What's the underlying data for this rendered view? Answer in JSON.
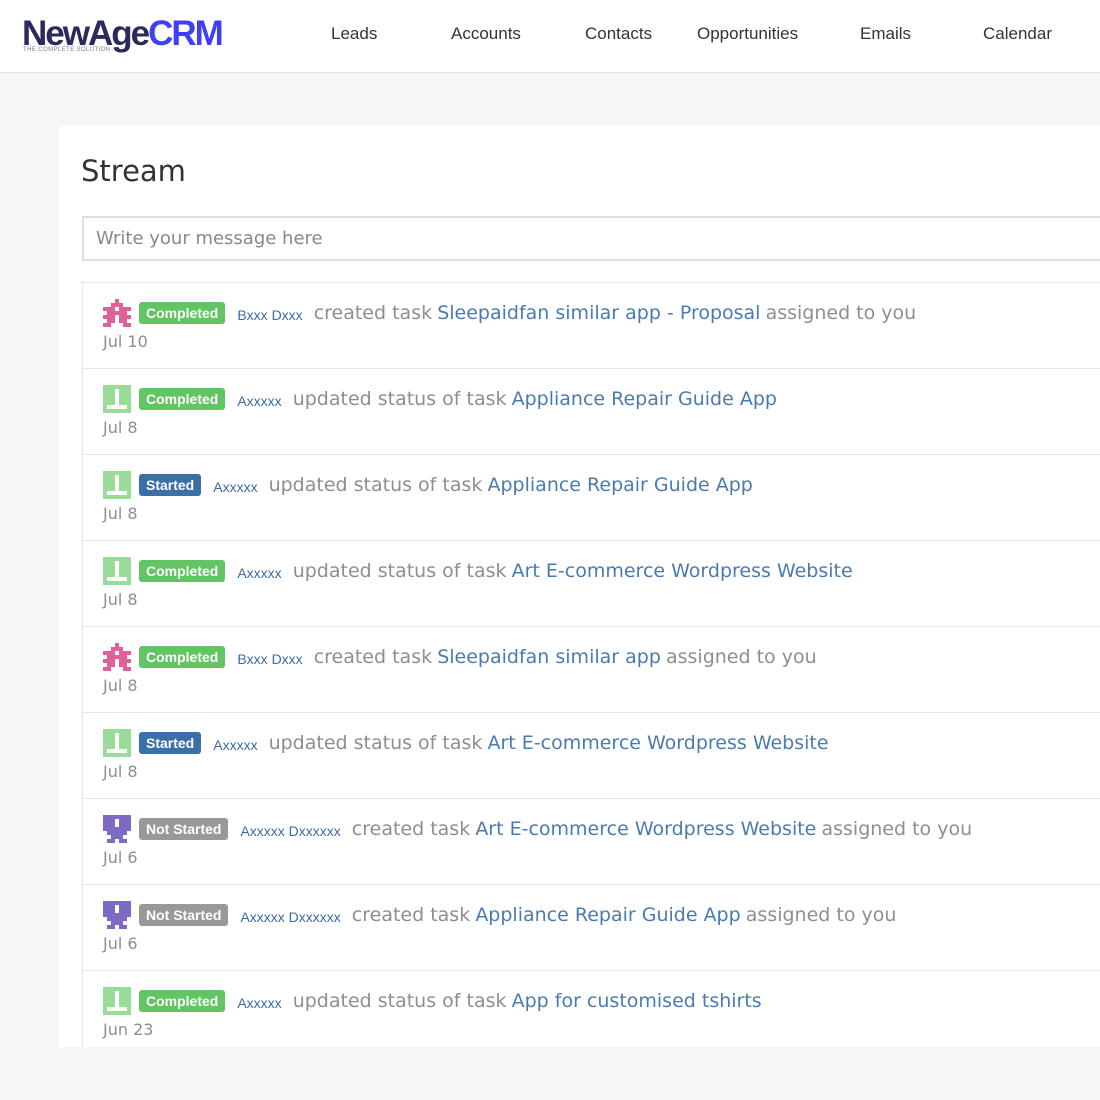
{
  "app": {
    "logo_main_a": "NewAge",
    "logo_main_b": "CRM",
    "logo_tagline": "THE COMPLETE SOLUTION",
    "colors": {
      "logo_dark": "#2b2a5c",
      "logo_accent": "#3f3ff5",
      "badge_completed": "#62c462",
      "badge_started": "#3a6fa8",
      "badge_not_started": "#999999",
      "link": "#4a7bb0"
    }
  },
  "nav": {
    "items": [
      "Leads",
      "Accounts",
      "Contacts",
      "Opportunities",
      "Emails",
      "Calendar"
    ]
  },
  "stream": {
    "title": "Stream",
    "input_placeholder": "Write your message here",
    "items": [
      {
        "avatar": "pink-invader-avatar-icon",
        "status": "Completed",
        "user": "Bxxx Dxxx",
        "action": "created task",
        "task": "Sleepaidfan similar app - Proposal",
        "suffix": "assigned to you",
        "date": "Jul 10"
      },
      {
        "avatar": "green-avatar-icon",
        "status": "Completed",
        "user": "Axxxxx",
        "action": "updated status of task",
        "task": "Appliance Repair Guide App",
        "suffix": "",
        "date": "Jul 8"
      },
      {
        "avatar": "green-avatar-icon",
        "status": "Started",
        "user": "Axxxxx",
        "action": "updated status of task",
        "task": "Appliance Repair Guide App",
        "suffix": "",
        "date": "Jul 8"
      },
      {
        "avatar": "green-avatar-icon",
        "status": "Completed",
        "user": "Axxxxx",
        "action": "updated status of task",
        "task": "Art E-commerce Wordpress Website",
        "suffix": "",
        "date": "Jul 8"
      },
      {
        "avatar": "pink-invader-avatar-icon",
        "status": "Completed",
        "user": "Bxxx Dxxx",
        "action": "created task",
        "task": "Sleepaidfan similar app",
        "suffix": "assigned to you",
        "date": "Jul 8"
      },
      {
        "avatar": "green-avatar-icon",
        "status": "Started",
        "user": "Axxxxx",
        "action": "updated status of task",
        "task": "Art E-commerce Wordpress Website",
        "suffix": "",
        "date": "Jul 8"
      },
      {
        "avatar": "purple-avatar-icon",
        "status": "Not Started",
        "user": "Axxxxx Dxxxxxx",
        "action": "created task",
        "task": "Art E-commerce Wordpress Website",
        "suffix": "assigned to you",
        "date": "Jul 6"
      },
      {
        "avatar": "purple-avatar-icon",
        "status": "Not Started",
        "user": "Axxxxx Dxxxxxx",
        "action": "created task",
        "task": "Appliance Repair Guide App",
        "suffix": "assigned to you",
        "date": "Jul 6"
      },
      {
        "avatar": "green-avatar-icon",
        "status": "Completed",
        "user": "Axxxxx",
        "action": "updated status of task",
        "task": "App for customised tshirts",
        "suffix": "",
        "date": "Jun 23"
      }
    ]
  }
}
